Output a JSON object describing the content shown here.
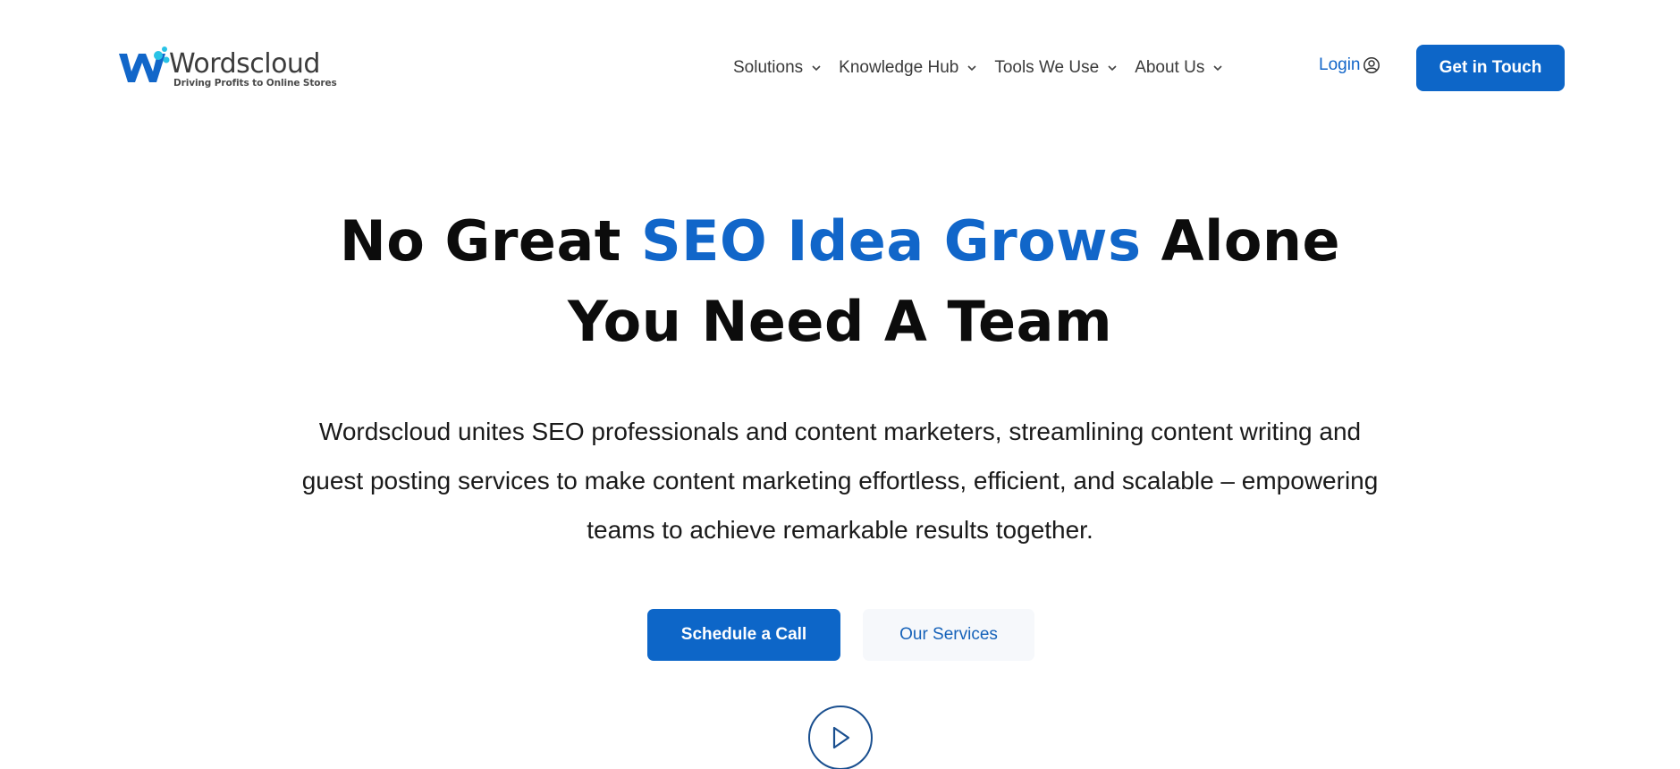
{
  "brand": {
    "name": "Wordscloud",
    "tagline": "Driving Profits to Online Stores",
    "accent_color": "#0d66c8"
  },
  "nav": {
    "items": [
      {
        "label": "Solutions",
        "icon": "chevron-down-icon"
      },
      {
        "label": "Knowledge Hub",
        "icon": "chevron-down-icon"
      },
      {
        "label": "Tools We Use",
        "icon": "chevron-down-icon"
      },
      {
        "label": "About Us",
        "icon": "chevron-down-icon"
      }
    ],
    "login_label": "Login",
    "login_icon": "user-circle-icon",
    "cta_label": "Get in Touch"
  },
  "hero": {
    "title_part1": "No Great ",
    "title_accent": "SEO Idea Grows",
    "title_part2": " Alone",
    "title_line2": "You Need A Team",
    "description": "Wordscloud unites SEO professionals and content marketers, streamlining content writing and guest posting services to make content marketing effortless, efficient, and scalable – empowering teams to achieve remarkable results together.",
    "primary_button": "Schedule a Call",
    "secondary_button": "Our Services",
    "play_icon": "play-icon"
  }
}
